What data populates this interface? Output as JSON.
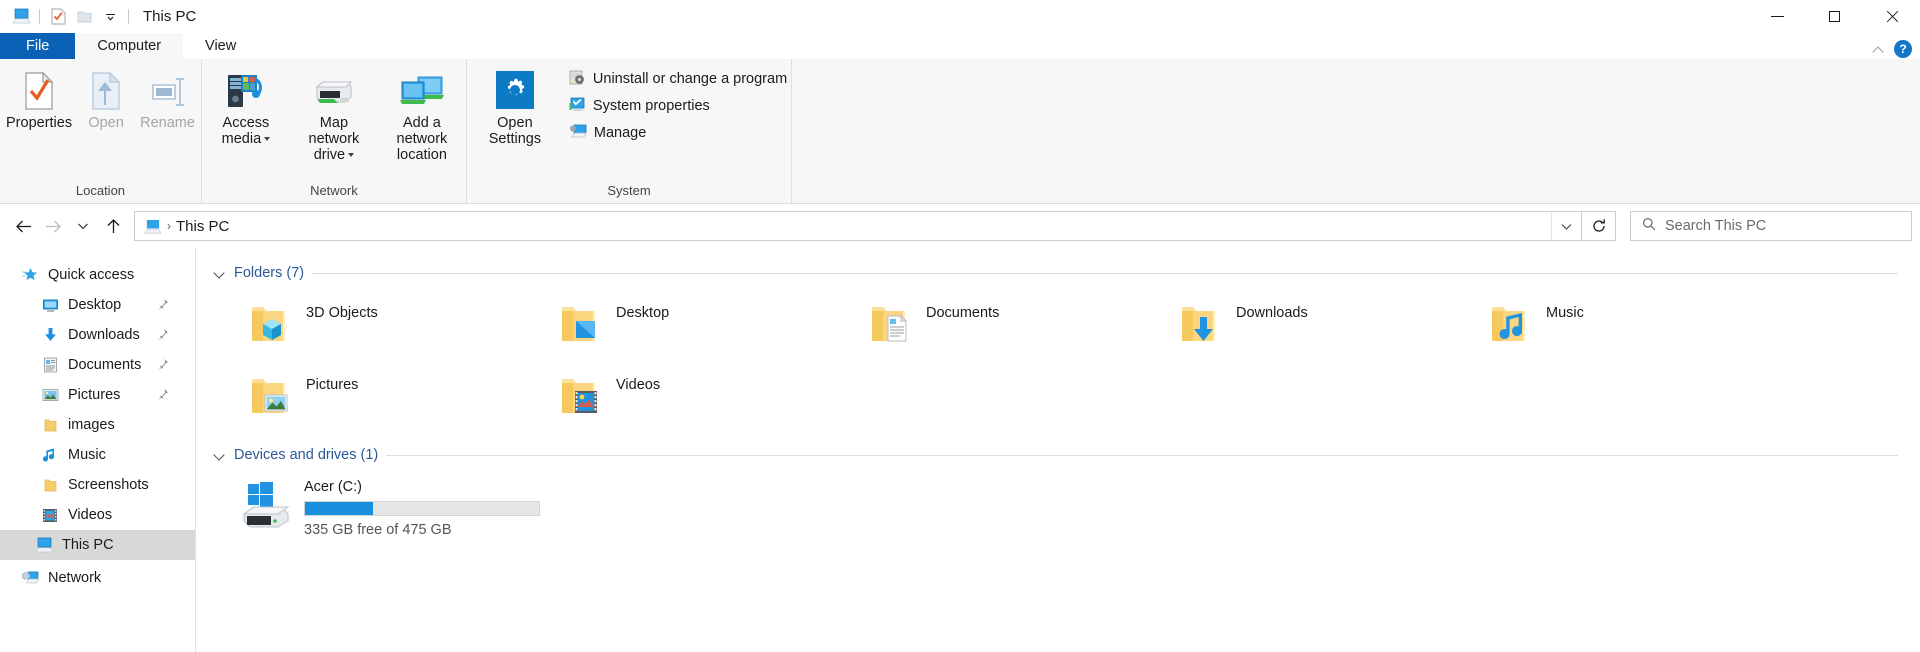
{
  "window": {
    "title": "This PC",
    "quick_access_icons": [
      "this-pc-icon",
      "properties-icon",
      "folder-icon",
      "customize-caret"
    ],
    "controls": {
      "minimize": "—",
      "maximize": "□",
      "close": "✕"
    }
  },
  "tabs": [
    {
      "label": "File",
      "state": "file"
    },
    {
      "label": "Computer",
      "state": "active"
    },
    {
      "label": "View",
      "state": "normal"
    }
  ],
  "tab_right": {
    "collapse": "chevron-up-icon",
    "help": "?"
  },
  "ribbon": {
    "groups": [
      {
        "label": "Location",
        "big_buttons": [
          {
            "label": "Properties",
            "icon": "properties-icon",
            "disabled": false
          },
          {
            "label": "Open",
            "icon": "open-icon",
            "disabled": true
          },
          {
            "label": "Rename",
            "icon": "rename-icon",
            "disabled": true
          }
        ]
      },
      {
        "label": "Network",
        "big_buttons": [
          {
            "label": "Access media",
            "icon": "access-media-icon",
            "disabled": false,
            "caret": true
          },
          {
            "label": "Map network drive",
            "icon": "map-network-drive-icon",
            "disabled": false,
            "caret": true
          },
          {
            "label": "Add a network location",
            "icon": "add-network-location-icon",
            "disabled": false
          }
        ]
      },
      {
        "label": "System",
        "big_buttons": [
          {
            "label": "Open Settings",
            "icon": "settings-gear-icon",
            "disabled": false
          }
        ],
        "small_buttons": [
          {
            "label": "Uninstall or change a program",
            "icon": "uninstall-program-icon"
          },
          {
            "label": "System properties",
            "icon": "system-properties-icon"
          },
          {
            "label": "Manage",
            "icon": "manage-icon"
          }
        ]
      }
    ]
  },
  "addressbar": {
    "back": "back-arrow-icon",
    "forward": "forward-arrow-icon",
    "recent": "chevron-down-icon",
    "up": "up-arrow-icon",
    "path_icon": "this-pc-icon",
    "crumb": "This PC",
    "dropdown": "chevron-down-icon",
    "refresh": "refresh-icon",
    "search_placeholder": "Search This PC",
    "search_value": ""
  },
  "navpane": [
    {
      "label": "Quick access",
      "icon": "quick-access-star-icon",
      "level": 0,
      "pinned": false,
      "selected": false
    },
    {
      "label": "Desktop",
      "icon": "desktop-icon",
      "level": 1,
      "pinned": true,
      "selected": false
    },
    {
      "label": "Downloads",
      "icon": "downloads-icon",
      "level": 1,
      "pinned": true,
      "selected": false
    },
    {
      "label": "Documents",
      "icon": "documents-icon",
      "level": 1,
      "pinned": true,
      "selected": false
    },
    {
      "label": "Pictures",
      "icon": "pictures-icon",
      "level": 1,
      "pinned": true,
      "selected": false
    },
    {
      "label": "images",
      "icon": "folder-icon",
      "level": 1,
      "pinned": false,
      "selected": false
    },
    {
      "label": "Music",
      "icon": "music-note-icon",
      "level": 1,
      "pinned": false,
      "selected": false
    },
    {
      "label": "Screenshots",
      "icon": "folder-icon",
      "level": 1,
      "pinned": false,
      "selected": false
    },
    {
      "label": "Videos",
      "icon": "videos-icon",
      "level": 1,
      "pinned": false,
      "selected": false
    },
    {
      "label": "This PC",
      "icon": "this-pc-icon",
      "level": 0,
      "pinned": false,
      "selected": true
    },
    {
      "label": "Network",
      "icon": "network-icon",
      "level": 0,
      "pinned": false,
      "selected": false
    }
  ],
  "main": {
    "sections": [
      {
        "title": "Folders (7)",
        "kind": "folders",
        "items": [
          {
            "label": "3D Objects",
            "icon": "folder-3dobjects-icon"
          },
          {
            "label": "Desktop",
            "icon": "folder-desktop-icon"
          },
          {
            "label": "Documents",
            "icon": "folder-documents-icon"
          },
          {
            "label": "Downloads",
            "icon": "folder-downloads-icon"
          },
          {
            "label": "Music",
            "icon": "folder-music-icon"
          },
          {
            "label": "Pictures",
            "icon": "folder-pictures-icon"
          },
          {
            "label": "Videos",
            "icon": "folder-videos-icon"
          }
        ]
      },
      {
        "title": "Devices and drives (1)",
        "kind": "drives",
        "items": [
          {
            "label": "Acer (C:)",
            "icon": "windows-drive-icon",
            "free_text": "335 GB free of 475 GB",
            "free_gb": 335,
            "total_gb": 475,
            "used_percent": 29
          }
        ]
      }
    ]
  },
  "colors": {
    "accent_blue": "#0b61b5",
    "link_blue": "#2b5797",
    "drive_bar": "#1a8fdd",
    "selection": "#d8d8d8",
    "ribbon_bg": "#f7f7f7",
    "folder_yellow": "#f9d67a"
  }
}
